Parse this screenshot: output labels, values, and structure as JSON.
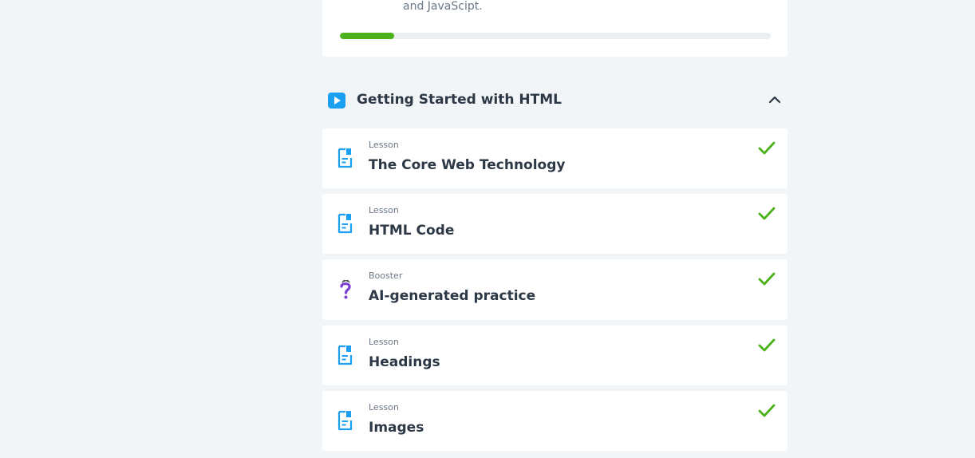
{
  "course": {
    "description_tail": "and JavaScipt.",
    "progress_fraction": 0.126
  },
  "module": {
    "icon": "play-icon",
    "title": "Getting Started with HTML",
    "toggle_icon": "chevron-up-icon"
  },
  "lessons": [
    {
      "type": "Lesson",
      "title": "The Core Web Technology",
      "icon": "document-icon",
      "status": "completed"
    },
    {
      "type": "Lesson",
      "title": "HTML Code",
      "icon": "document-icon",
      "status": "completed"
    },
    {
      "type": "Booster",
      "title": "AI-generated practice",
      "icon": "question-mark-icon",
      "status": "completed"
    },
    {
      "type": "Lesson",
      "title": "Headings",
      "icon": "document-icon",
      "status": "completed"
    },
    {
      "type": "Lesson",
      "title": "Images",
      "icon": "document-icon",
      "status": "completed"
    }
  ],
  "colors": {
    "accent_blue": "#1b9ff1",
    "success_green": "#4bb21b",
    "booster_purple": "#7d3fd1",
    "background": "#f2f5f7"
  }
}
